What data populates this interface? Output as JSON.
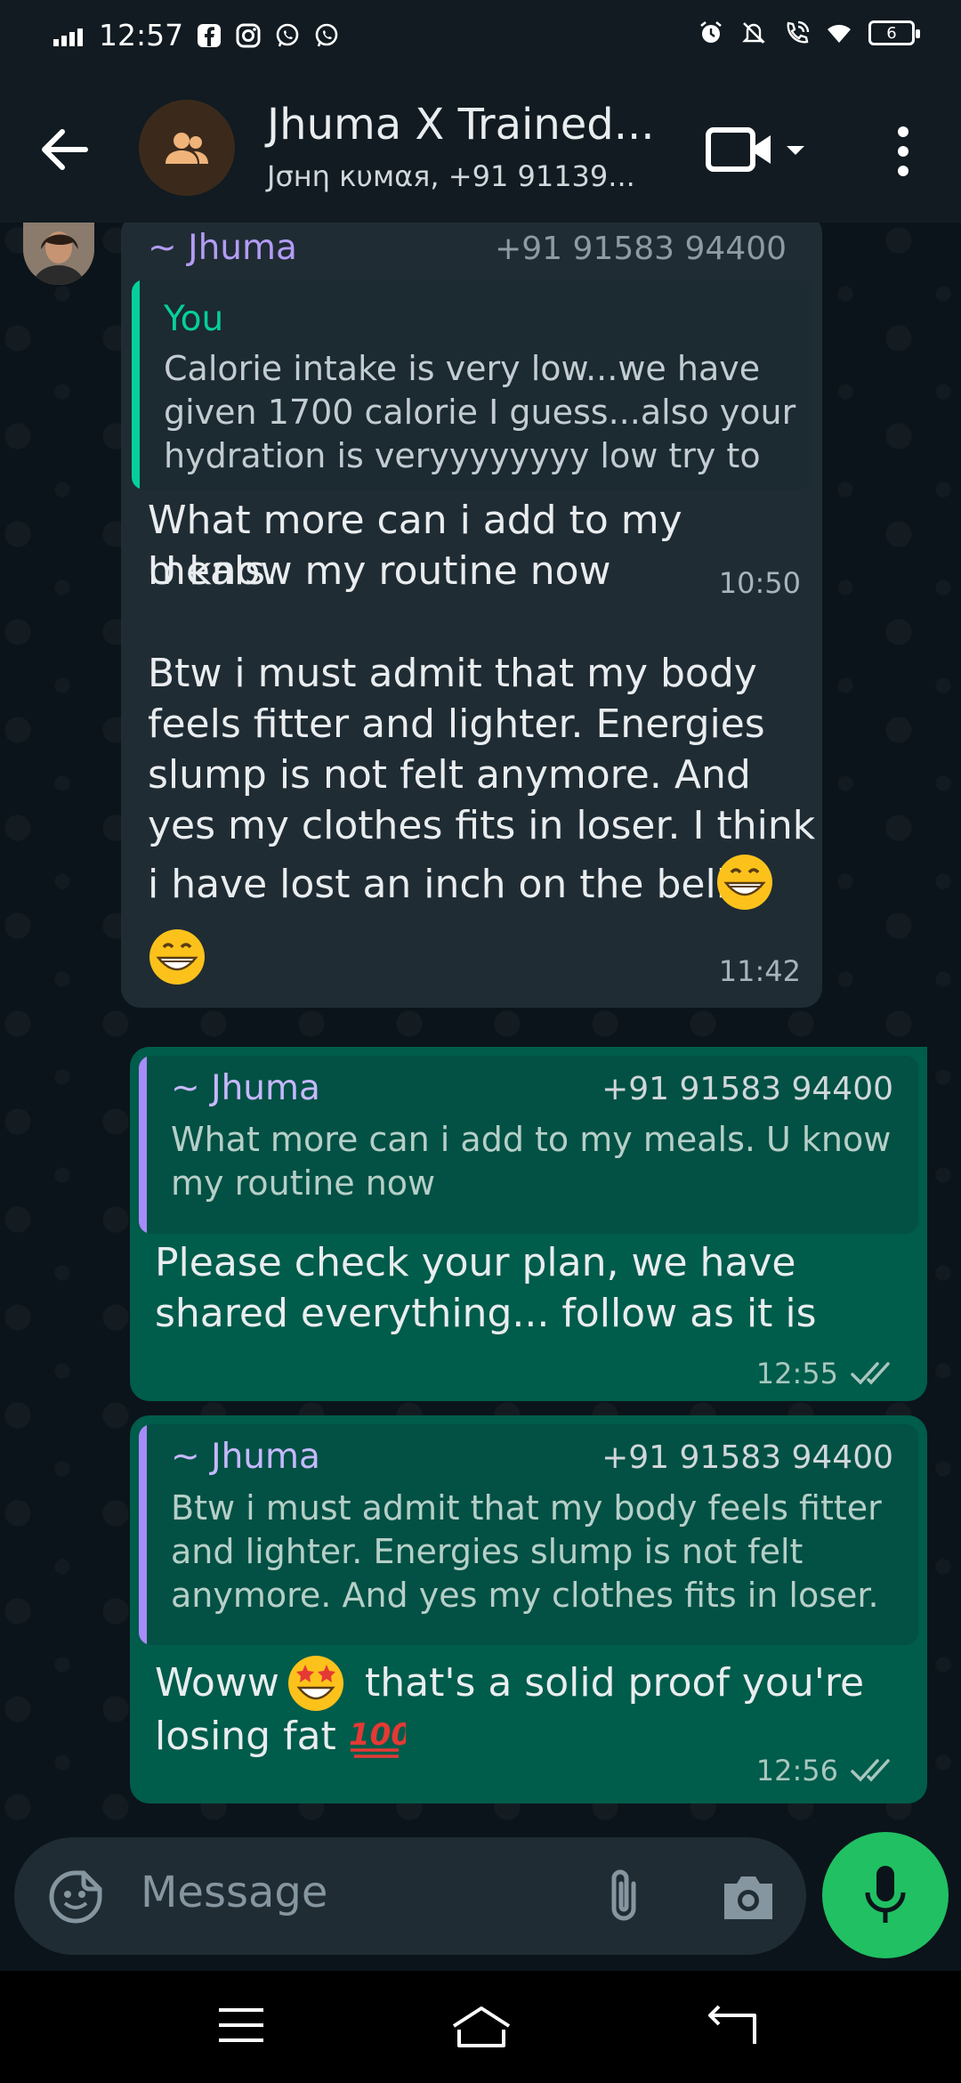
{
  "status_bar": {
    "time": "12:57",
    "battery_level": "6"
  },
  "header": {
    "title": "Jhuma X Trained...",
    "subtitle": "Jσнη кυмαя, +91 91139..."
  },
  "messages": [
    {
      "direction": "incoming",
      "sender_name": "~ Jhuma",
      "sender_phone": "+91 91583 94400",
      "quote": {
        "author": "You",
        "lines": [
          "Calorie intake is very low...we have",
          "given 1700 calorie I guess...also your",
          "hydration is veryyyyyyyy low try to p..."
        ]
      },
      "lines": [
        "What more can i add to my meals.",
        "U know my routine now"
      ],
      "time": "10:50"
    },
    {
      "direction": "incoming",
      "lines": [
        "Btw i must admit that my body",
        "feels fitter and lighter. Energies",
        "slump is not felt anymore. And",
        "yes my clothes fits in loser. I think",
        "i have lost an inch on the belly"
      ],
      "time": "11:42"
    },
    {
      "direction": "outgoing",
      "quote": {
        "author": "~ Jhuma",
        "phone": "+91 91583 94400",
        "lines": [
          "What more can i add to my meals. U know",
          "my routine now"
        ]
      },
      "lines": [
        "Please check your plan, we have",
        "shared everything... follow as it is"
      ],
      "time": "12:55",
      "read": true
    },
    {
      "direction": "outgoing",
      "quote": {
        "author": "~ Jhuma",
        "phone": "+91 91583 94400",
        "lines": [
          "Btw i must admit that my body feels fitter",
          "and lighter. Energies slump is not felt",
          "anymore. And yes my clothes fits in loser. ..."
        ]
      },
      "lines": [
        "Woww",
        "that's a solid proof you're",
        "losing fat"
      ],
      "time": "12:56",
      "read": true
    }
  ],
  "composer": {
    "placeholder": "Message"
  },
  "colors": {
    "incoming_bubble": "#202c33",
    "outgoing_bubble": "#005c4b",
    "accent_green": "#21c063",
    "quote_you": "#06cf9c",
    "quote_jhuma": "#a78bfa"
  }
}
